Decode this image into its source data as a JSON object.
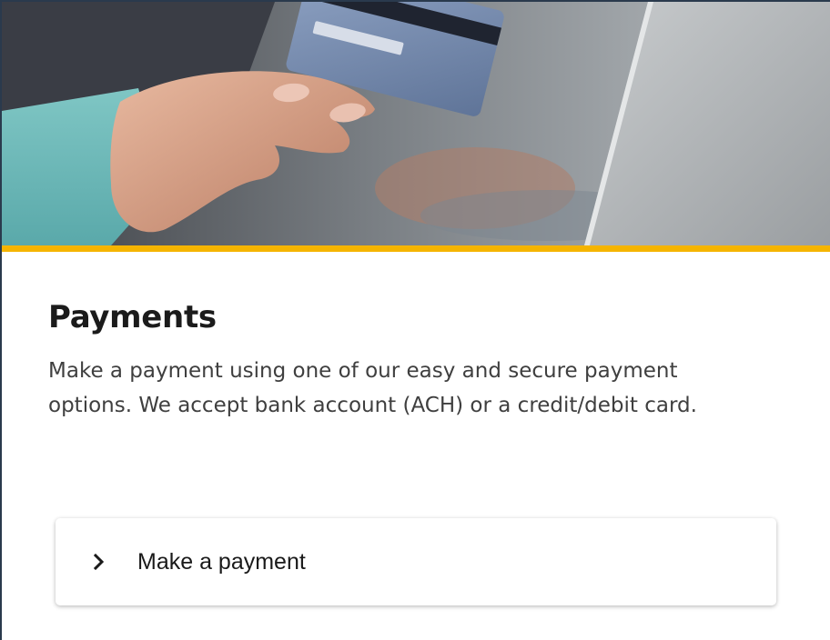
{
  "hero": {
    "image": "hand-holding-credit-card-at-laptop",
    "accent_color": "#f5b400"
  },
  "section": {
    "title": "Payments",
    "description": "Make a payment using one of our easy and secure payment options. We accept bank account (ACH) or a credit/debit card."
  },
  "action": {
    "label": "Make a payment",
    "icon": "chevron-right-icon"
  }
}
